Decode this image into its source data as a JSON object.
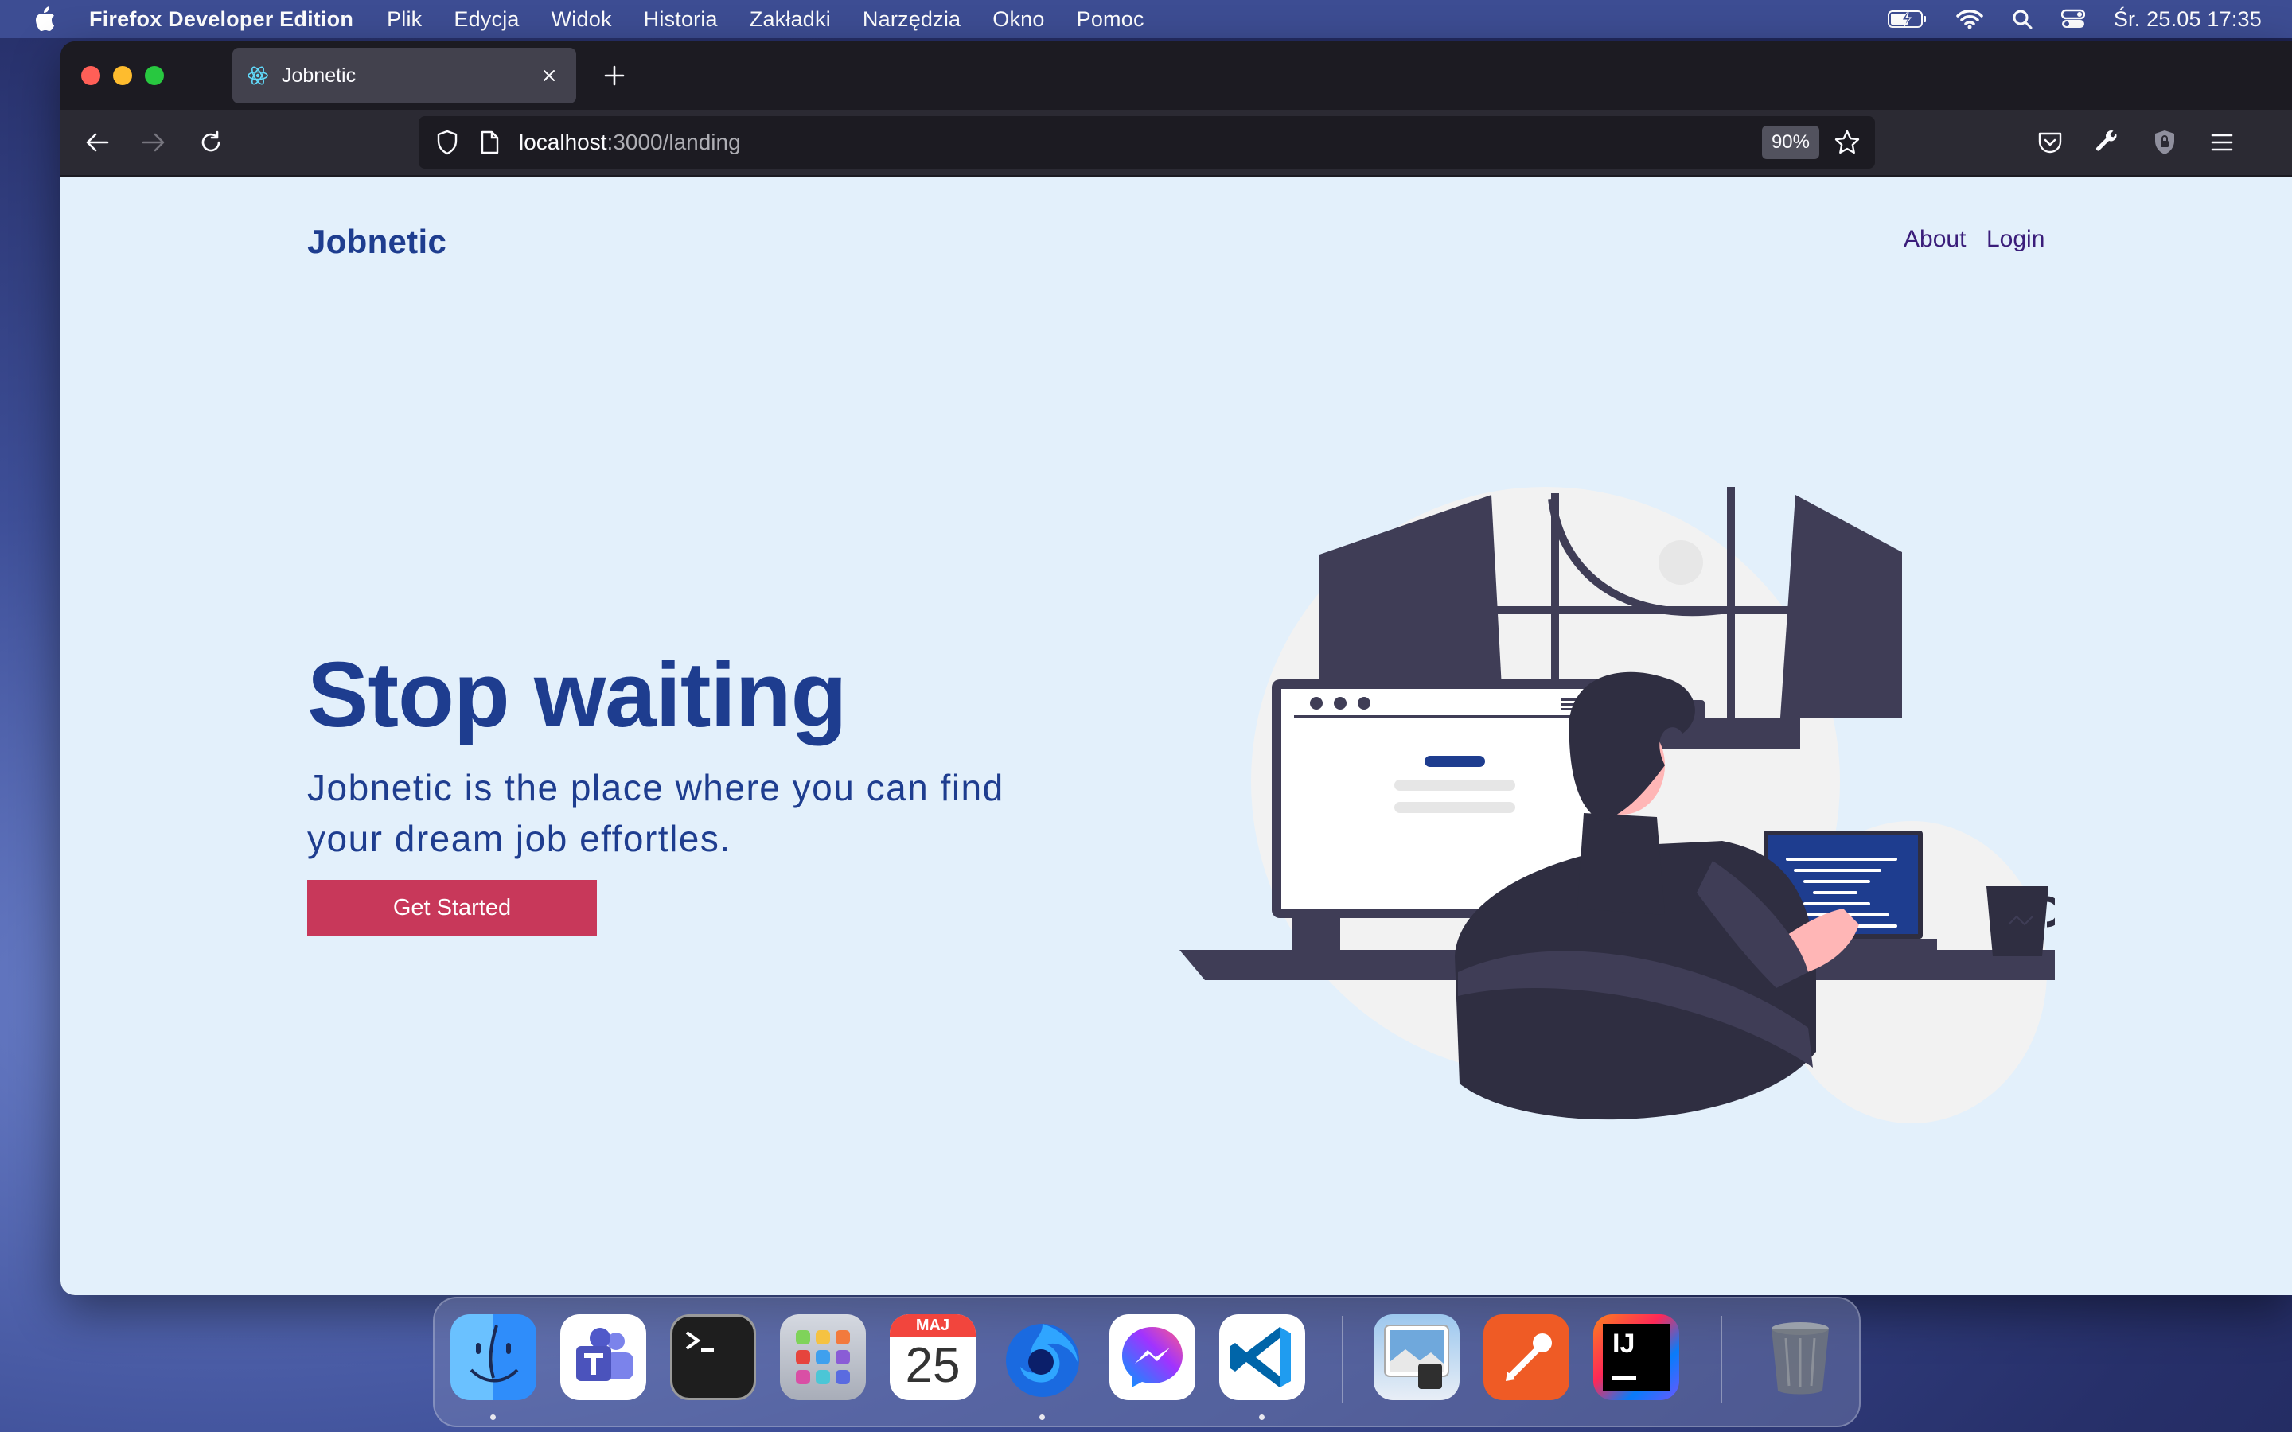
{
  "menubar": {
    "app_name": "Firefox Developer Edition",
    "items": [
      "Plik",
      "Edycja",
      "Widok",
      "Historia",
      "Zakładki",
      "Narzędzia",
      "Okno",
      "Pomoc"
    ],
    "datetime": "Śr. 25.05  17:35"
  },
  "browser": {
    "tab_title": "Jobnetic",
    "url_host": "localhost",
    "url_path": ":3000/landing",
    "zoom": "90%"
  },
  "page": {
    "brand": "Jobnetic",
    "nav": {
      "about": "About",
      "login": "Login"
    },
    "hero_title": "Stop waiting",
    "hero_subtitle": "Jobnetic is the place where you can find your dream job effortles.",
    "cta_label": "Get Started"
  },
  "dock": {
    "calendar_month": "MAJ",
    "calendar_day": "25",
    "intellij_label": "IJ"
  },
  "colors": {
    "brand_blue": "#1e3d8f",
    "cta": "#c8385a",
    "page_bg": "#e3f0fb"
  }
}
